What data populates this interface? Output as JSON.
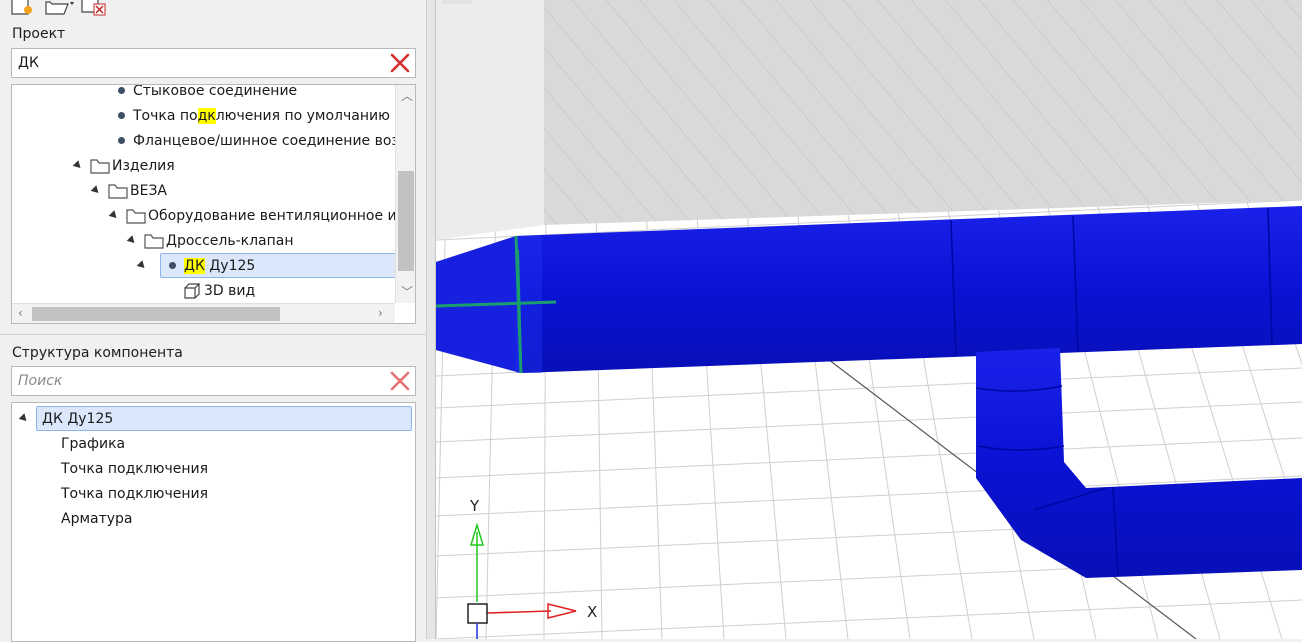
{
  "project_panel": {
    "label": "Проект",
    "search_value": "ДК",
    "tree": [
      {
        "text": "Стыковое соединение",
        "kind": "bullet",
        "indent": 1
      },
      {
        "pre": "Точка по",
        "hl": "дк",
        "post": "лючения по умолчанию",
        "kind": "bullet",
        "indent": 1
      },
      {
        "text": "Фланцевое/шинное соединение возд",
        "kind": "bullet",
        "indent": 1
      },
      {
        "text": "Изделия",
        "kind": "folder",
        "indent": 0
      },
      {
        "text": "ВЕЗА",
        "kind": "folder",
        "indent": 1
      },
      {
        "text": "Оборудование вентиляционное и ",
        "kind": "folder",
        "indent": 2
      },
      {
        "text": "Дроссель-клапан",
        "kind": "folder",
        "indent": 3
      },
      {
        "pre": "",
        "hl": "ДК",
        "post": " Ду125",
        "kind": "bullet-selected",
        "indent": 4
      },
      {
        "text": "3D вид",
        "kind": "cube",
        "indent": 5
      }
    ]
  },
  "structure_panel": {
    "label": "Структура компонента",
    "search_placeholder": "Поиск",
    "root": "ДК Ду125",
    "children": [
      "Графика",
      "Точка подключения",
      "Точка подключения",
      "Арматура"
    ]
  },
  "viewport": {
    "axis_y": "Y",
    "axis_x": "X",
    "duct_color": "#0a14d8",
    "accent_color": "#1a9e6e"
  }
}
